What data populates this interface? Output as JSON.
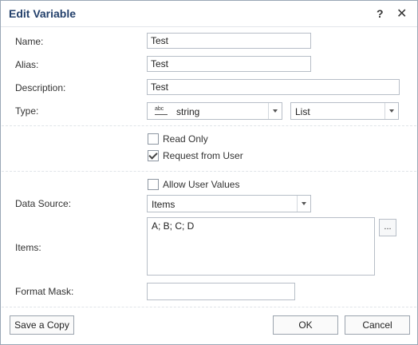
{
  "dialog": {
    "title": "Edit Variable",
    "help_glyph": "?",
    "close_glyph": "✕"
  },
  "fields": {
    "name": {
      "label": "Name:",
      "value": "Test"
    },
    "alias": {
      "label": "Alias:",
      "value": "Test"
    },
    "description": {
      "label": "Description:",
      "value": "Test"
    },
    "type": {
      "label": "Type:",
      "icon_text": "abc",
      "type_value": "string",
      "kind_value": "List"
    },
    "read_only": {
      "label": "Read Only",
      "checked": false
    },
    "request_from_user": {
      "label": "Request from User",
      "checked": true
    },
    "allow_user_values": {
      "label": "Allow User Values",
      "checked": false
    },
    "data_source": {
      "label": "Data Source:",
      "value": "Items"
    },
    "items": {
      "label": "Items:",
      "value": "A; B; C; D",
      "ellipsis": "..."
    },
    "format_mask": {
      "label": "Format Mask:",
      "value": ""
    }
  },
  "buttons": {
    "save_copy": "Save a Copy",
    "ok": "OK",
    "cancel": "Cancel"
  }
}
